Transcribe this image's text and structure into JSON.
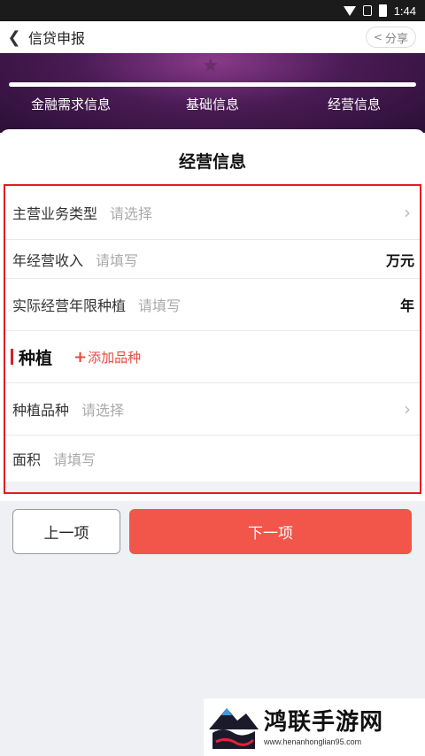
{
  "status_bar": {
    "time": "1:44"
  },
  "nav": {
    "title": "信贷申报",
    "share_label": "分享"
  },
  "steps": [
    {
      "label": "金融需求信息"
    },
    {
      "label": "基础信息"
    },
    {
      "label": "经营信息"
    }
  ],
  "card": {
    "title": "经营信息"
  },
  "form": {
    "main_business_type": {
      "label": "主营业务类型",
      "placeholder": "请选择"
    },
    "annual_income": {
      "label": "年经营收入",
      "placeholder": "请填写",
      "unit": "万元"
    },
    "years_planting": {
      "label": "实际经营年限种植",
      "placeholder": "请填写",
      "unit": "年"
    },
    "section": {
      "title": "种植",
      "add_label": "添加品种"
    },
    "variety": {
      "label": "种植品种",
      "placeholder": "请选择"
    },
    "area": {
      "label": "面积",
      "placeholder": "请填写"
    }
  },
  "buttons": {
    "prev": "上一项",
    "next": "下一项"
  },
  "watermark": {
    "title": "鸿联手游网",
    "url": "www.henanhonglian95.com"
  },
  "colors": {
    "accent_red": "#f2554a",
    "highlight_red": "#e01c24",
    "hero_purple": "#4a1b55"
  }
}
